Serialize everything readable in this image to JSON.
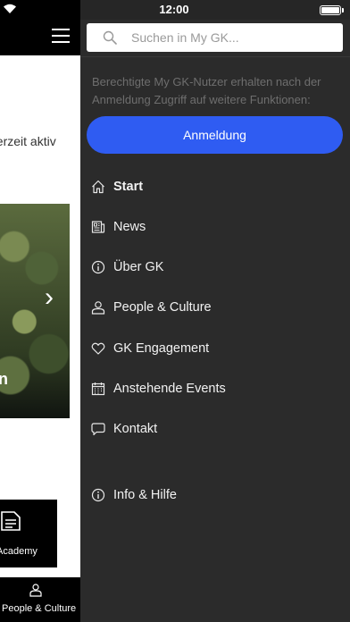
{
  "status_bar": {
    "time": "12:00"
  },
  "background_app": {
    "text_fragment": "derzeit aktiv",
    "card_fragment": "n",
    "tile_label": "Academy",
    "tab_label": "People & Culture"
  },
  "drawer": {
    "search": {
      "placeholder": "Suchen in My GK..."
    },
    "info_text": "Berechtigte My GK-Nutzer erhalten nach der Anmeldung Zugriff auf weitere Funktionen:",
    "login_label": "Anmeldung",
    "menu": [
      {
        "label": "Start",
        "icon": "home-icon",
        "active": true
      },
      {
        "label": "News",
        "icon": "news-icon"
      },
      {
        "label": "Über GK",
        "icon": "info-icon"
      },
      {
        "label": "People & Culture",
        "icon": "person-icon"
      },
      {
        "label": "GK Engagement",
        "icon": "heart-icon"
      },
      {
        "label": "Anstehende Events",
        "icon": "calendar-icon"
      },
      {
        "label": "Kontakt",
        "icon": "chat-icon"
      },
      {
        "label": "Info & Hilfe",
        "icon": "info-icon"
      }
    ]
  },
  "colors": {
    "accent": "#2f5cf2",
    "drawer_bg": "#2b2b2b"
  }
}
